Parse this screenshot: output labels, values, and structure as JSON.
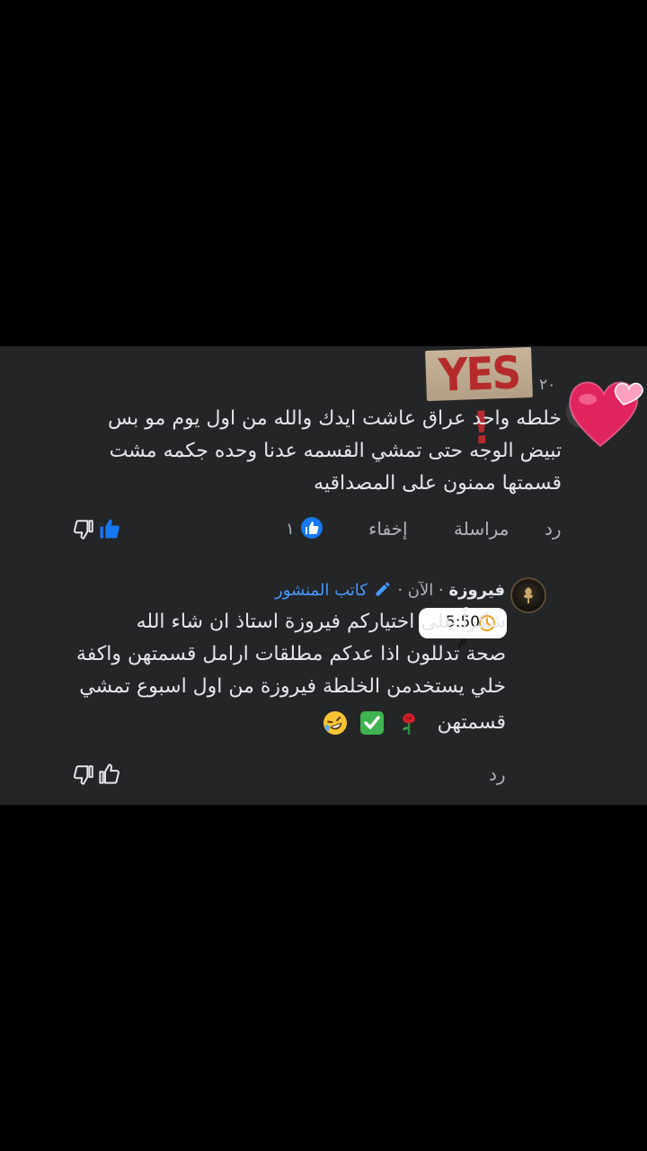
{
  "comment": {
    "sticker_text": "YES !",
    "time": "٢٠",
    "text_lines": [
      "خلطه واحد عراق عاشت ايدك والله من اول يوم مو بس",
      "تبيض الوجه حتى تمشي القسمه عدنا وحده جكمه مشت",
      "قسمتها ممنون على المصداقيه"
    ],
    "actions": {
      "reply": "رد",
      "message": "مراسلة",
      "hide": "إخفاء",
      "like_count": "١"
    }
  },
  "reply": {
    "name": "فيروزة",
    "separator": "·",
    "time": "الآن",
    "author_label": "كاتب المنشور",
    "clock_time": "5:50 م",
    "text_lines": [
      "شكراً على اختياركم فيروزة استاذ ان شاء الله",
      "صحة تدللون اذا عدكم مطلقات ارامل قسمتهن واكفة",
      "خلي يستخدمن الخلطة فيروزة من اول اسبوع تمشي",
      "قسمتهن"
    ],
    "emoji_names": [
      "rose-emoji",
      "check-mark-emoji",
      "rofl-emoji"
    ],
    "actions": {
      "reply": "رد"
    }
  },
  "colors": {
    "panel_bg": "#242526",
    "text": "#e4e6eb",
    "muted": "#b0b3b8",
    "accent_blue": "#1877f2",
    "author_blue": "#4599ff"
  }
}
